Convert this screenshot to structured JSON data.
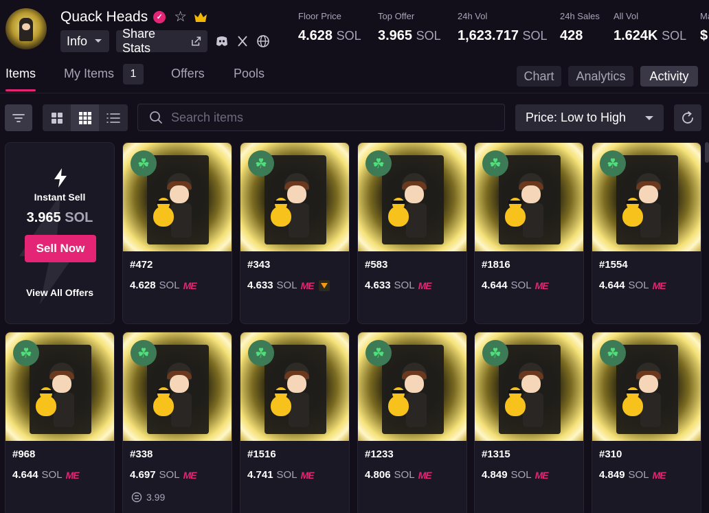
{
  "collection": {
    "name": "Quack Heads",
    "verified_glyph": "✓",
    "info_label": "Info",
    "share_label": "Share Stats"
  },
  "stats": [
    {
      "label": "Floor Price",
      "value": "4.628",
      "unit": "SOL"
    },
    {
      "label": "Top Offer",
      "value": "3.965",
      "unit": "SOL"
    },
    {
      "label": "24h Vol",
      "value": "1,623.717",
      "unit": "SOL"
    },
    {
      "label": "24h Sales",
      "value": "428",
      "unit": ""
    },
    {
      "label": "All Vol",
      "value": "1.624K",
      "unit": "SOL"
    },
    {
      "label": "Ma",
      "value": "$",
      "unit": ""
    }
  ],
  "tabs": {
    "items": "Items",
    "my_items": "My Items",
    "my_items_count": "1",
    "offers": "Offers",
    "pools": "Pools"
  },
  "view_tabs": {
    "chart": "Chart",
    "analytics": "Analytics",
    "activity": "Activity",
    "active": "Activity"
  },
  "search": {
    "placeholder": "Search items"
  },
  "sort": {
    "selected": "Price: Low to High"
  },
  "instant_sell": {
    "title": "Instant Sell",
    "amount": "3.965",
    "unit": "SOL",
    "button": "Sell Now",
    "link": "View All Offers"
  },
  "items": [
    {
      "name": "#472",
      "price": "4.628",
      "unit": "SOL",
      "marketplace": "ME"
    },
    {
      "name": "#343",
      "price": "4.633",
      "unit": "SOL",
      "marketplace": "ME"
    },
    {
      "name": "#583",
      "price": "4.633",
      "unit": "SOL",
      "marketplace": "ME"
    },
    {
      "name": "#1816",
      "price": "4.644",
      "unit": "SOL",
      "marketplace": "ME"
    },
    {
      "name": "#1554",
      "price": "4.644",
      "unit": "SOL",
      "marketplace": "ME"
    },
    {
      "name": "#968",
      "price": "4.644",
      "unit": "SOL",
      "marketplace": "ME"
    },
    {
      "name": "#338",
      "price": "4.697",
      "unit": "SOL",
      "marketplace": "ME",
      "extra": "3.99"
    },
    {
      "name": "#1516",
      "price": "4.741",
      "unit": "SOL",
      "marketplace": "ME"
    },
    {
      "name": "#1233",
      "price": "4.806",
      "unit": "SOL",
      "marketplace": "ME"
    },
    {
      "name": "#1315",
      "price": "4.849",
      "unit": "SOL",
      "marketplace": "ME"
    },
    {
      "name": "#310",
      "price": "4.849",
      "unit": "SOL",
      "marketplace": "ME"
    }
  ],
  "colors": {
    "accent": "#e42575",
    "background": "#120f1b",
    "card": "#1b1826",
    "badge": "#3d7a56"
  },
  "icons": [
    "verified-icon",
    "star-icon",
    "crown-icon",
    "chevron-down-icon",
    "share-icon",
    "discord-icon",
    "x-icon",
    "globe-icon",
    "filter-icon",
    "grid-large-icon",
    "grid-small-icon",
    "list-icon",
    "search-icon",
    "refresh-icon",
    "bolt-icon",
    "clover-icon",
    "magic-eden-icon",
    "tensor-icon",
    "pool-icon"
  ]
}
